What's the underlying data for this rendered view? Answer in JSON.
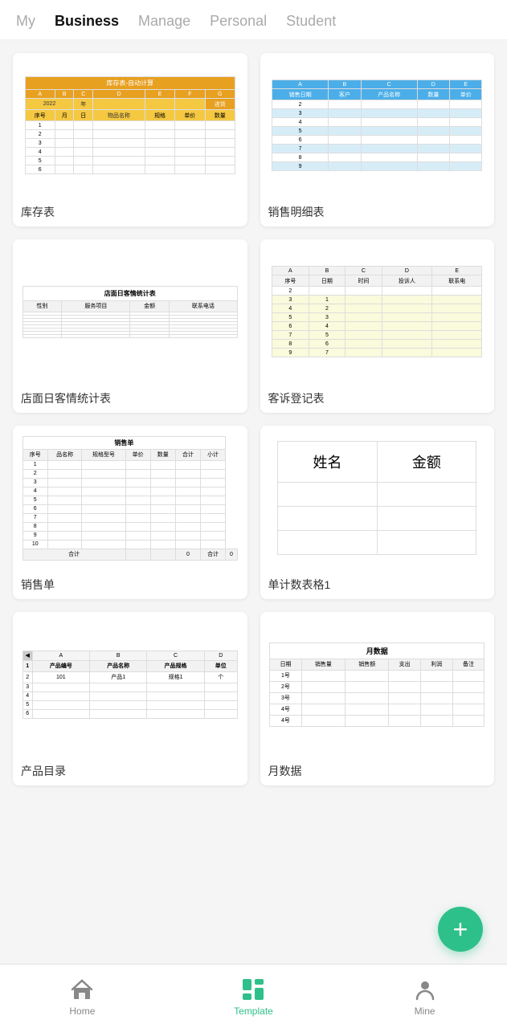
{
  "nav": {
    "items": [
      {
        "label": "My",
        "active": false
      },
      {
        "label": "Business",
        "active": true
      },
      {
        "label": "Manage",
        "active": false
      },
      {
        "label": "Personal",
        "active": false
      },
      {
        "label": "Student",
        "active": false
      }
    ]
  },
  "cards": [
    {
      "id": "inventory",
      "label": "库存表"
    },
    {
      "id": "sales-detail",
      "label": "销售明细表"
    },
    {
      "id": "customer-stats",
      "label": "店面日客情统计表"
    },
    {
      "id": "complaint",
      "label": "客诉登记表"
    },
    {
      "id": "sales-invoice",
      "label": "销售单"
    },
    {
      "id": "count-table",
      "label": "单计数表格1"
    },
    {
      "id": "product",
      "label": "产品目录"
    },
    {
      "id": "month-data",
      "label": "月数据"
    }
  ],
  "bottom_nav": {
    "items": [
      {
        "label": "Home",
        "active": false,
        "icon": "home"
      },
      {
        "label": "Template",
        "active": true,
        "icon": "template"
      },
      {
        "label": "Mine",
        "active": false,
        "icon": "mine"
      }
    ]
  },
  "fab": {
    "icon": "+"
  }
}
